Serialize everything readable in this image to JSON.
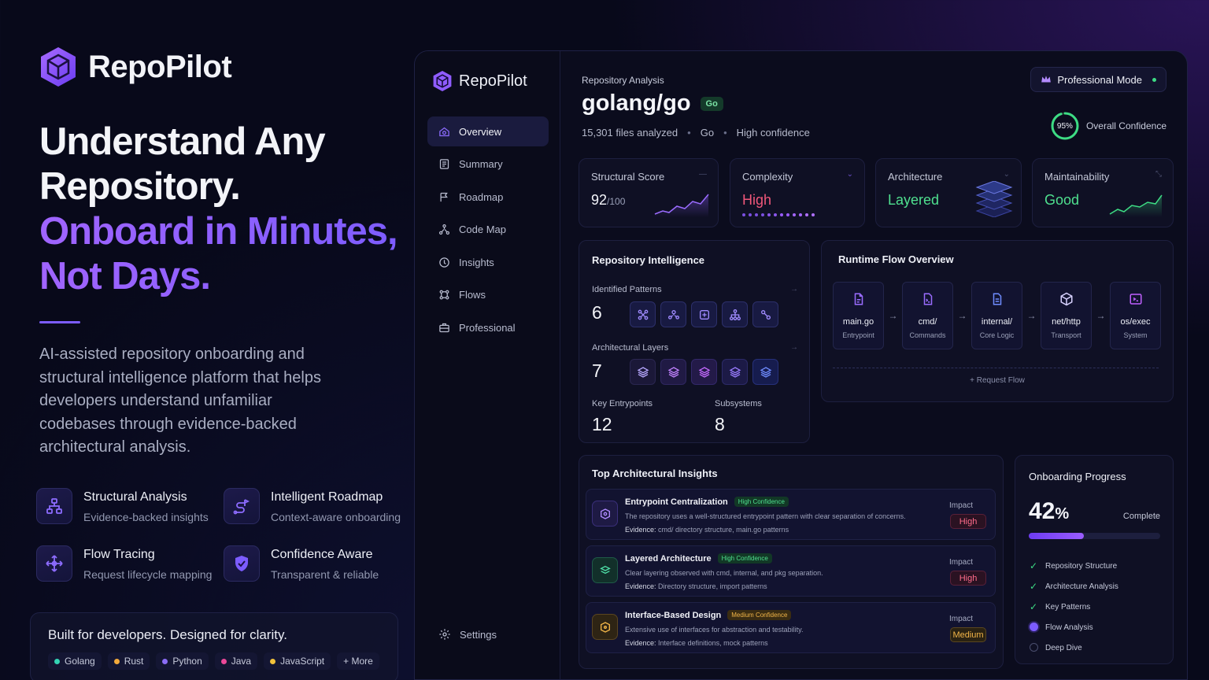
{
  "hero": {
    "brand": "RepoPilot",
    "title_lines": [
      "Understand Any",
      "Repository."
    ],
    "accent_lines": [
      "Onboard in Minutes,",
      "Not Days."
    ],
    "description": "AI-assisted repository onboarding and structural intelligence platform that helps developers understand unfamiliar codebases through evidence-backed architectural analysis.",
    "features": [
      {
        "title": "Structural Analysis",
        "subtitle": "Evidence-backed insights",
        "icon": "hierarchy-icon"
      },
      {
        "title": "Intelligent Roadmap",
        "subtitle": "Context-aware onboarding",
        "icon": "roadmap-icon"
      },
      {
        "title": "Flow Tracing",
        "subtitle": "Request lifecycle mapping",
        "icon": "flow-arrows-icon"
      },
      {
        "title": "Confidence Aware",
        "subtitle": "Transparent & reliable",
        "icon": "shield-check-icon"
      }
    ],
    "built_for": "Built for developers. Designed for clarity.",
    "languages": [
      {
        "name": "Golang",
        "color": "#34d3b4"
      },
      {
        "name": "Rust",
        "color": "#f2a93b"
      },
      {
        "name": "Python",
        "color": "#8b6cf6"
      },
      {
        "name": "Java",
        "color": "#ec4899"
      },
      {
        "name": "JavaScript",
        "color": "#f2c23b"
      }
    ],
    "more_label": "+ More"
  },
  "app": {
    "brand": "RepoPilot",
    "nav": [
      {
        "label": "Overview",
        "icon": "overview-icon",
        "active": true
      },
      {
        "label": "Summary",
        "icon": "summary-icon",
        "active": false
      },
      {
        "label": "Roadmap",
        "icon": "roadmap-flag-icon",
        "active": false
      },
      {
        "label": "Code Map",
        "icon": "code-map-icon",
        "active": false
      },
      {
        "label": "Insights",
        "icon": "insights-icon",
        "active": false
      },
      {
        "label": "Flows",
        "icon": "flows-icon",
        "active": false
      },
      {
        "label": "Professional",
        "icon": "professional-icon",
        "active": false
      }
    ],
    "settings": "Settings",
    "header": {
      "label": "Repository Analysis",
      "repo": "golang/go",
      "badge": "Go",
      "files": "15,301 files analyzed",
      "language": "Go",
      "confidence": "High confidence",
      "mode": "Professional Mode",
      "overall_pct": 95,
      "overall_pct_label": "95%",
      "overall_label": "Overall Confidence"
    },
    "metrics": [
      {
        "label": "Structural Score",
        "value": "92",
        "suffix": "/100",
        "color": "#f4f5fa"
      },
      {
        "label": "Complexity",
        "value": "High",
        "suffix": "",
        "color": "#f0577a"
      },
      {
        "label": "Architecture",
        "value": "Layered",
        "suffix": "",
        "color": "#4fe08f"
      },
      {
        "label": "Maintainability",
        "value": "Good",
        "suffix": "",
        "color": "#4fe08f"
      }
    ],
    "intelligence": {
      "title": "Repository Intelligence",
      "patterns_label": "Identified Patterns",
      "patterns": "6",
      "layers_label": "Architectural Layers",
      "layers": "7",
      "entrypoints_label": "Key Entrypoints",
      "entrypoints": "12",
      "subsystems_label": "Subsystems",
      "subsystems": "8"
    },
    "runtime": {
      "title": "Runtime Flow Overview",
      "nodes": [
        {
          "title": "main.go",
          "sub": "Entrypoint"
        },
        {
          "title": "cmd/",
          "sub": "Commands"
        },
        {
          "title": "internal/",
          "sub": "Core Logic"
        },
        {
          "title": "net/http",
          "sub": "Transport"
        },
        {
          "title": "os/exec",
          "sub": "System"
        }
      ],
      "arrow": "→",
      "footer": "Request Flow"
    },
    "insights": {
      "title": "Top Architectural Insights",
      "impact_label": "Impact",
      "evidence_label": "Evidence:",
      "items": [
        {
          "title": "Entrypoint Centralization",
          "confidence": "High Confidence",
          "desc": "The repository uses a well-structured entrypoint pattern with clear separation of concerns.",
          "evidence": "cmd/ directory structure, main.go patterns",
          "impact": "High"
        },
        {
          "title": "Layered Architecture",
          "confidence": "High Confidence",
          "desc": "Clear layering observed with cmd, internal, and pkg separation.",
          "evidence": "Directory structure, import patterns",
          "impact": "High"
        },
        {
          "title": "Interface-Based Design",
          "confidence": "Medium Confidence",
          "desc": "Extensive use of interfaces for abstraction and testability.",
          "evidence": "Interface definitions, mock patterns",
          "impact": "Medium"
        }
      ]
    },
    "onboarding": {
      "title": "Onboarding Progress",
      "pct": "42",
      "pct_unit": "%",
      "progress": 42,
      "complete_label": "Complete",
      "steps": [
        {
          "label": "Repository Structure",
          "state": "done"
        },
        {
          "label": "Architecture Analysis",
          "state": "done"
        },
        {
          "label": "Key Patterns",
          "state": "done"
        },
        {
          "label": "Flow Analysis",
          "state": "current"
        },
        {
          "label": "Deep Dive",
          "state": "todo"
        }
      ]
    }
  }
}
